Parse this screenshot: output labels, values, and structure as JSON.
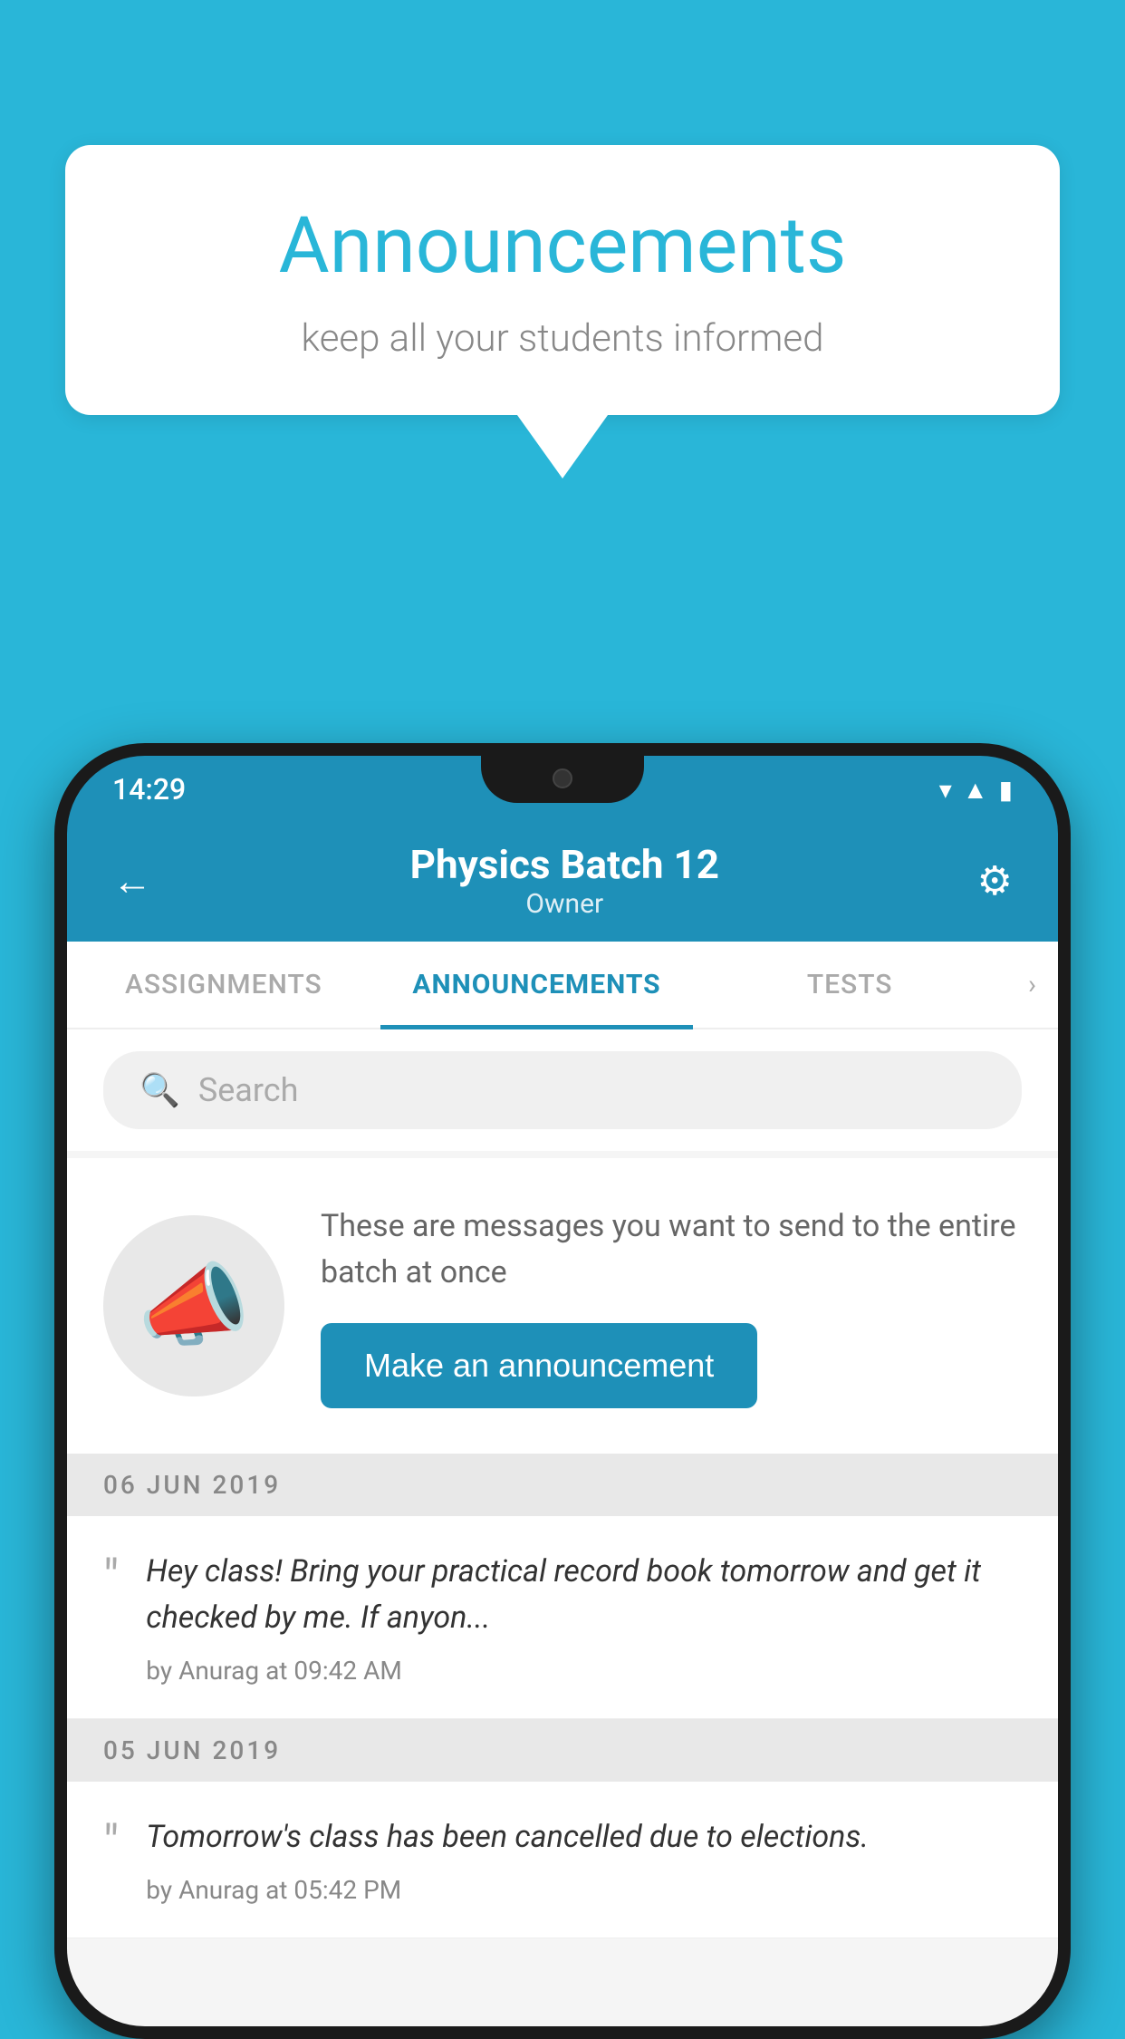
{
  "background_color": "#29b6d8",
  "speech_bubble": {
    "title": "Announcements",
    "subtitle": "keep all your students informed"
  },
  "status_bar": {
    "time": "14:29",
    "icons": [
      "wifi",
      "signal",
      "battery"
    ]
  },
  "app_header": {
    "back_label": "←",
    "title": "Physics Batch 12",
    "subtitle": "Owner",
    "settings_label": "⚙"
  },
  "tabs": [
    {
      "label": "ASSIGNMENTS",
      "active": false
    },
    {
      "label": "ANNOUNCEMENTS",
      "active": true
    },
    {
      "label": "TESTS",
      "active": false
    }
  ],
  "search": {
    "placeholder": "Search"
  },
  "promo": {
    "description": "These are messages you want to send to the entire batch at once",
    "button_label": "Make an announcement"
  },
  "announcements": [
    {
      "date": "06  JUN  2019",
      "text": "Hey class! Bring your practical record book tomorrow and get it checked by me. If anyon...",
      "meta": "by Anurag at 09:42 AM"
    },
    {
      "date": "05  JUN  2019",
      "text": "Tomorrow's class has been cancelled due to elections.",
      "meta": "by Anurag at 05:42 PM"
    }
  ]
}
